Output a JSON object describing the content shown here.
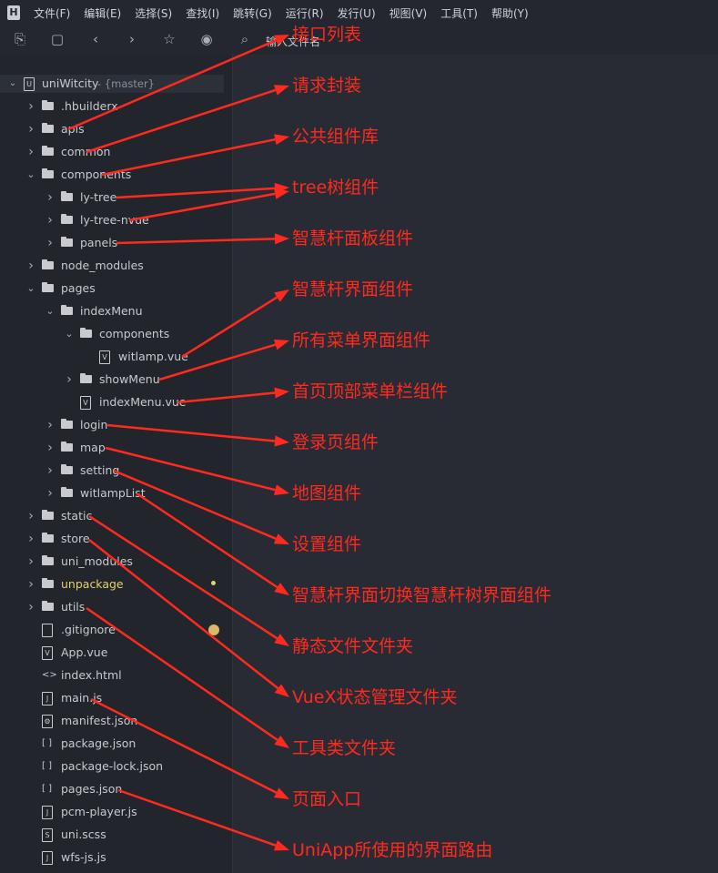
{
  "menubar": {
    "items": [
      "文件(F)",
      "编辑(E)",
      "选择(S)",
      "查找(I)",
      "跳转(G)",
      "运行(R)",
      "发行(U)",
      "视图(V)",
      "工具(T)",
      "帮助(Y)"
    ]
  },
  "toolbar": {
    "search_label": "输入文件名"
  },
  "tree": {
    "root": {
      "name": "uniWitcity",
      "branch": "- {master}"
    },
    "items": [
      {
        "name": ".hbuilderx"
      },
      {
        "name": "apis"
      },
      {
        "name": "common"
      },
      {
        "name": "components"
      },
      {
        "name": "ly-tree"
      },
      {
        "name": "ly-tree-nvue"
      },
      {
        "name": "panels"
      },
      {
        "name": "node_modules"
      },
      {
        "name": "pages"
      },
      {
        "name": "indexMenu"
      },
      {
        "name": "components"
      },
      {
        "name": "witlamp.vue"
      },
      {
        "name": "showMenu"
      },
      {
        "name": "indexMenu.vue"
      },
      {
        "name": "login"
      },
      {
        "name": "map"
      },
      {
        "name": "setting"
      },
      {
        "name": "witlampList"
      },
      {
        "name": "static"
      },
      {
        "name": "store"
      },
      {
        "name": "uni_modules"
      },
      {
        "name": "unpackage"
      },
      {
        "name": "utils"
      },
      {
        "name": ".gitignore"
      },
      {
        "name": "App.vue"
      },
      {
        "name": "index.html"
      },
      {
        "name": "main.js"
      },
      {
        "name": "manifest.json"
      },
      {
        "name": "package.json"
      },
      {
        "name": "package-lock.json"
      },
      {
        "name": "pages.json"
      },
      {
        "name": "pcm-player.js"
      },
      {
        "name": "uni.scss"
      },
      {
        "name": "wfs-js.js"
      }
    ]
  },
  "annotations": [
    "接口列表",
    "请求封装",
    "公共组件库",
    "tree树组件",
    "智慧杆面板组件",
    "智慧杆界面组件",
    "所有菜单界面组件",
    "首页顶部菜单栏组件",
    "登录页组件",
    "地图组件",
    "设置组件",
    "智慧杆界面切换智慧杆树界面组件",
    "静态文件文件夹",
    "VueX状态管理文件夹",
    "工具类文件夹",
    "页面入口",
    "UniApp所使用的界面路由"
  ],
  "colors": {
    "annotation": "#ff2a1f",
    "background": "#272a33",
    "sidebar": "#22252c",
    "highlight_text": "#e6cf6e"
  }
}
